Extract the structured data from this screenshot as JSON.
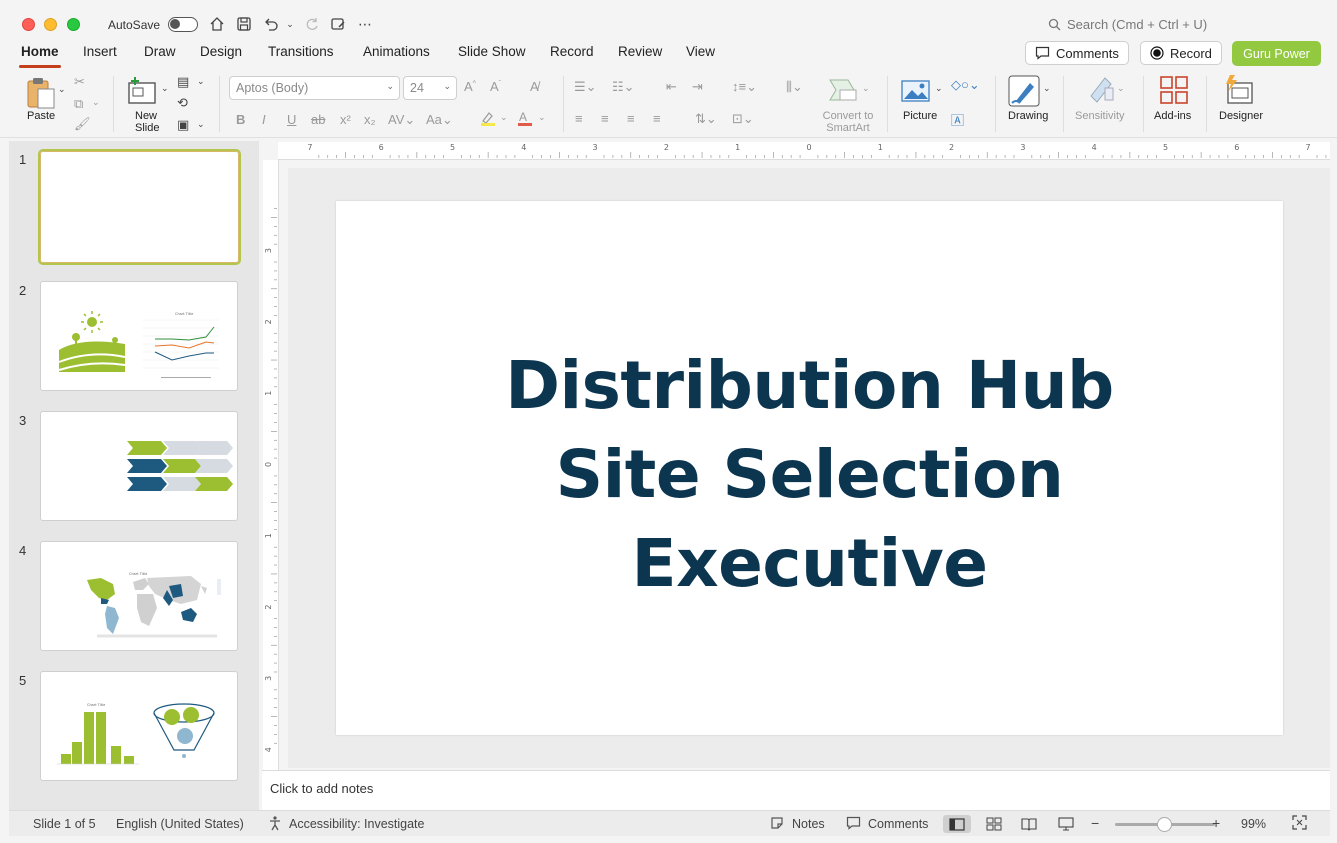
{
  "titlebar": {
    "autosave_label": "AutoSave",
    "search_placeholder": "Search (Cmd + Ctrl + U)"
  },
  "tabs": [
    {
      "label": "Home",
      "active": true
    },
    {
      "label": "Insert"
    },
    {
      "label": "Draw"
    },
    {
      "label": "Design"
    },
    {
      "label": "Transitions"
    },
    {
      "label": "Animations"
    },
    {
      "label": "Slide Show"
    },
    {
      "label": "Record"
    },
    {
      "label": "Review"
    },
    {
      "label": "View"
    }
  ],
  "header_buttons": {
    "comments": "Comments",
    "record": "Record",
    "guru": "Guru Power"
  },
  "ribbon": {
    "paste": "Paste",
    "new_slide_1": "New",
    "new_slide_2": "Slide",
    "font_name": "Aptos (Body)",
    "font_size": "24",
    "convert_1": "Convert to",
    "convert_2": "SmartArt",
    "picture": "Picture",
    "drawing": "Drawing",
    "sensitivity": "Sensitivity",
    "addins": "Add-ins",
    "designer": "Designer"
  },
  "slides": [
    {
      "number": "1"
    },
    {
      "number": "2"
    },
    {
      "number": "3"
    },
    {
      "number": "4"
    },
    {
      "number": "5"
    }
  ],
  "slide": {
    "title_line1": "Distribution Hub",
    "title_line2": "Site Selection",
    "title_line3": "Executive"
  },
  "notes_placeholder": "Click to add notes",
  "status": {
    "slide_of": "Slide 1 of 5",
    "language": "English (United States)",
    "accessibility": "Accessibility: Investigate",
    "notes": "Notes",
    "comments": "Comments",
    "zoom": "99%"
  },
  "colors": {
    "accent_tab": "#c43e1c",
    "guru_green": "#92c940",
    "title_navy": "#0c3550",
    "lime": "#9bbf30",
    "steel_blue": "#1e5a80"
  }
}
